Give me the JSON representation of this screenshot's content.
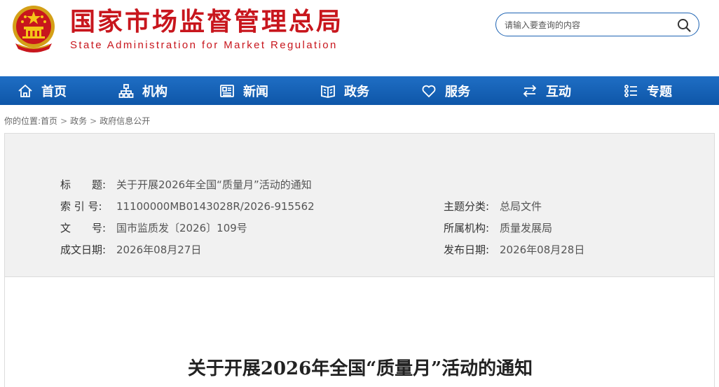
{
  "header": {
    "title_cn": "国家市场监督管理总局",
    "title_en": "State Administration for Market Regulation",
    "search_placeholder": "请输入要查询的内容"
  },
  "nav": {
    "items": [
      {
        "label": "首页",
        "icon": "home-icon"
      },
      {
        "label": "机构",
        "icon": "org-chart-icon"
      },
      {
        "label": "新闻",
        "icon": "news-icon"
      },
      {
        "label": "政务",
        "icon": "government-icon"
      },
      {
        "label": "服务",
        "icon": "heart-icon"
      },
      {
        "label": "互动",
        "icon": "exchange-arrows-icon"
      },
      {
        "label": "专题",
        "icon": "topic-list-icon"
      }
    ]
  },
  "breadcrumb": {
    "prefix": "你的位置:",
    "items": [
      "首页",
      "政务",
      "政府信息公开"
    ],
    "separator": ">"
  },
  "info": {
    "title_label": "标　　题:",
    "title_value": "关于开展2026年全国“质量月”活动的通知",
    "index_label": "索 引 号:",
    "index_value": "11100000MB0143028R/2026-915562",
    "docno_label": "文　　号:",
    "docno_value": "国市监质发〔2026〕109号",
    "date_label": "成文日期:",
    "date_value": "2026年08月27日",
    "category_label": "主题分类:",
    "category_value": "总局文件",
    "org_label": "所属机构:",
    "org_value": "质量发展局",
    "publish_label": "发布日期:",
    "publish_value": "2026年08月28日"
  },
  "document": {
    "title": "关于开展2026年全国“质量月”活动的通知"
  },
  "colors": {
    "brand_red": "#c8161d",
    "nav_blue": "#1565b8"
  }
}
